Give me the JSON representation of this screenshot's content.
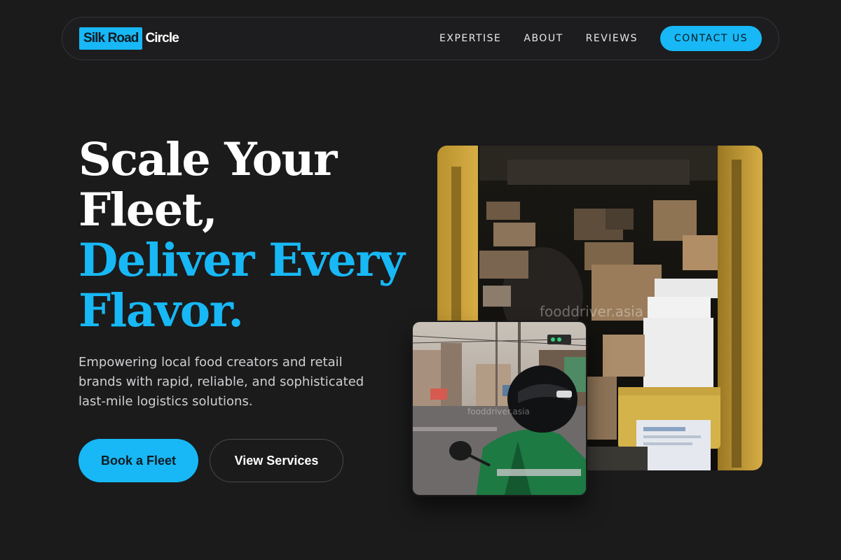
{
  "brand": {
    "name_highlight": "Silk Road",
    "name_rest": "Circle",
    "accent_color": "#17b8f5"
  },
  "nav": {
    "links": [
      "EXPERTISE",
      "ABOUT",
      "REVIEWS"
    ],
    "cta": "CONTACT US"
  },
  "hero": {
    "headline_line1": "Scale Your",
    "headline_line2": "Fleet,",
    "headline_line3": "Deliver Every",
    "headline_line4": "Flavor.",
    "subtitle": "Empowering local food creators and retail brands with rapid, reliable, and sophisticated last-mile logistics solutions.",
    "primary_button": "Book a Fleet",
    "secondary_button": "View Services"
  },
  "images": {
    "van_watermark": "fooddriver.asia",
    "rider_watermark": "fooddriver.asia"
  }
}
